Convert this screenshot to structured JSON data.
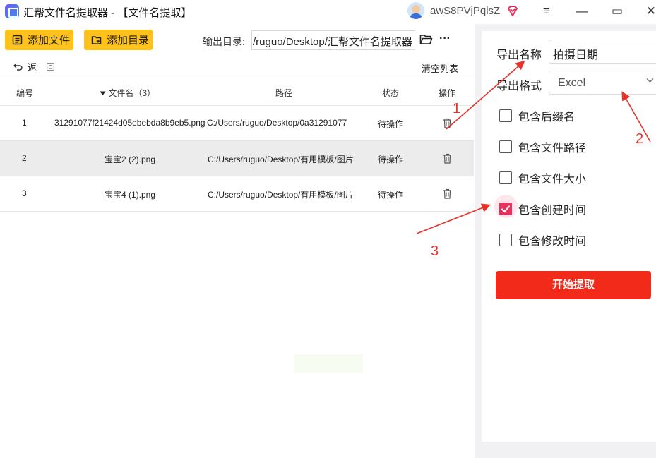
{
  "window": {
    "title": "汇帮文件名提取器 - 【文件名提取】",
    "username": "awS8PVjPqlsZ",
    "menu_glyph": "≡",
    "minimize_glyph": "—",
    "maximize_glyph": "▭",
    "close_glyph": "✕"
  },
  "toolbar": {
    "add_file_label": "添加文件",
    "add_dir_label": "添加目录",
    "output_label": "输出目录:",
    "output_path": "/ruguo/Desktop/汇帮文件名提取器",
    "more_glyph": "···",
    "back_label": "返　回",
    "clear_label": "清空列表"
  },
  "table": {
    "headers": {
      "index": "编号",
      "filename": "文件名（3）",
      "path": "路径",
      "status": "状态",
      "action": "操作"
    },
    "rows": [
      {
        "index": "1",
        "filename": "31291077f21424d05ebebda8b9eb5.png",
        "path": "C:/Users/ruguo/Desktop/0a31291077",
        "status": "待操作",
        "selected": false
      },
      {
        "index": "2",
        "filename": "宝宝2 (2).png",
        "path": "C:/Users/ruguo/Desktop/有用模板/图片",
        "status": "待操作",
        "selected": true
      },
      {
        "index": "3",
        "filename": "宝宝4 (1).png",
        "path": "C:/Users/ruguo/Desktop/有用模板/图片",
        "status": "待操作",
        "selected": false
      }
    ]
  },
  "settings": {
    "export_name_label": "导出名称",
    "export_name_value": "拍摄日期",
    "export_format_label": "导出格式",
    "export_format_value": "Excel",
    "options": [
      {
        "label": "包含后缀名",
        "checked": false
      },
      {
        "label": "包含文件路径",
        "checked": false
      },
      {
        "label": "包含文件大小",
        "checked": false
      },
      {
        "label": "包含创建时间",
        "checked": true
      },
      {
        "label": "包含修改时间",
        "checked": false
      }
    ],
    "start_label": "开始提取"
  },
  "annotations": {
    "color": "#e8322a",
    "labels": [
      "1",
      "2",
      "3"
    ]
  },
  "colors": {
    "button_yellow": "#ffc21a",
    "start_red": "#f22a1a",
    "checkbox_pink": "#e8305f"
  }
}
